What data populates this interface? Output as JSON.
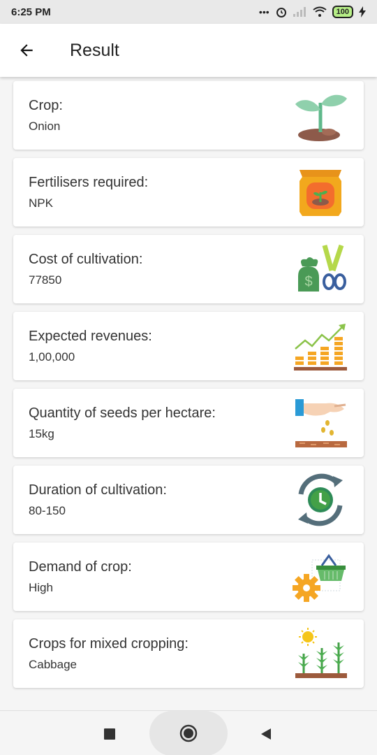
{
  "status_bar": {
    "time": "6:25 PM",
    "battery": "100"
  },
  "app_bar": {
    "title": "Result"
  },
  "cards": [
    {
      "label": "Crop:",
      "value": "Onion",
      "icon": "sprout-icon"
    },
    {
      "label": "Fertilisers required:",
      "value": "NPK",
      "icon": "fertiliser-bag-icon"
    },
    {
      "label": "Cost of cultivation:",
      "value": "77850",
      "icon": "money-bag-shears-icon"
    },
    {
      "label": "Expected revenues:",
      "value": "1,00,000",
      "icon": "revenue-growth-icon"
    },
    {
      "label": "Quantity of seeds per hectare:",
      "value": "15kg",
      "icon": "sowing-seeds-icon"
    },
    {
      "label": "Duration of cultivation:",
      "value": "80-150",
      "icon": "clock-cycle-icon"
    },
    {
      "label": "Demand of crop:",
      "value": "High",
      "icon": "basket-gear-icon"
    },
    {
      "label": "Crops for mixed cropping:",
      "value": "Cabbage",
      "icon": "mixed-crops-icon"
    }
  ],
  "colors": {
    "app_bar": "#ffffff",
    "background": "#f5f5f5",
    "status_bar": "#e9e9e9"
  }
}
